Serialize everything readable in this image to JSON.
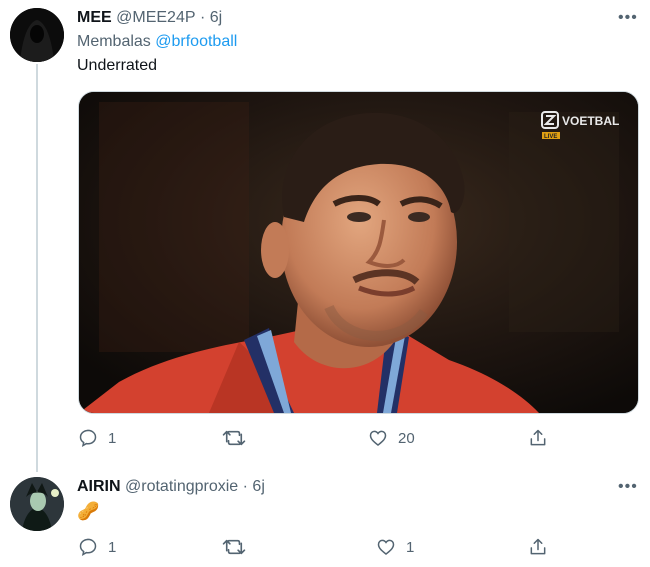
{
  "tweet1": {
    "name": "MEE",
    "handle": "@MEE24P",
    "time": "· 6j",
    "reply_prefix": "Membalas",
    "reply_to": "@brfootball",
    "text": "Underrated",
    "media": {
      "brand": "VOETBAL",
      "live_badge": "LIVE"
    },
    "actions": {
      "reply_count": "1",
      "like_count": "20"
    }
  },
  "tweet2": {
    "name": "AIRIN",
    "handle": "@rotatingproxie",
    "time": "· 6j",
    "emoji": "🥜",
    "actions": {
      "reply_count": "1",
      "like_count": "1"
    }
  },
  "more_label": "•••",
  "colors": {
    "link": "#1d9bf0",
    "secondary": "#536471",
    "line": "#cfd9de"
  }
}
